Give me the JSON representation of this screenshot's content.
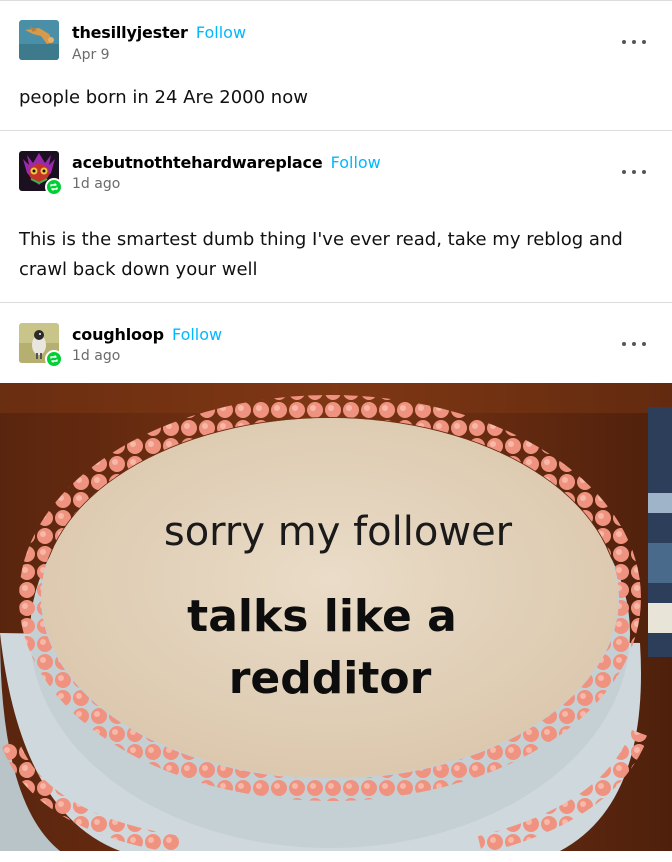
{
  "posts": [
    {
      "username": "thesillyjester",
      "follow_label": "Follow",
      "date": "Apr 9",
      "body": "people born in 24 Are 2000 now",
      "avatar_icon": "giraffe-photo-avatar"
    },
    {
      "username": "acebutnothtehardwareplace",
      "follow_label": "Follow",
      "date": "1d ago",
      "body": "This is the smartest dumb thing I've ever read, take my reblog and crawl back down your well",
      "avatar_icon": "majoras-mask-avatar",
      "badge_icon": "reblog-icon"
    },
    {
      "username": "coughloop",
      "follow_label": "Follow",
      "date": "1d ago",
      "avatar_icon": "bird-photo-avatar",
      "badge_icon": "reblog-icon",
      "image": {
        "line1": "sorry my follower",
        "line2": "talks like a",
        "line3": "redditor"
      }
    }
  ],
  "colors": {
    "follow": "#00b8ff",
    "reblog_badge": "#00cf35",
    "frosting": "#f0957f",
    "cake_top": "#e8d9c3",
    "wood": "#6b2e12"
  }
}
